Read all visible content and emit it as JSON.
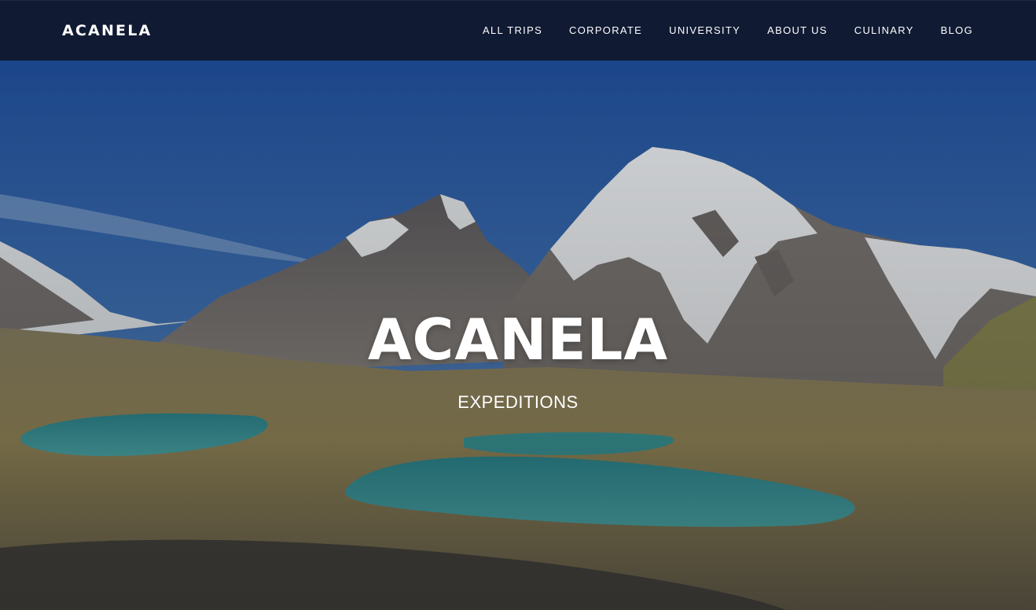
{
  "brand": {
    "logo_text": "ACANELA"
  },
  "nav": {
    "items": [
      {
        "label": "ALL TRIPS"
      },
      {
        "label": "CORPORATE"
      },
      {
        "label": "UNIVERSITY"
      },
      {
        "label": "ABOUT US"
      },
      {
        "label": "CULINARY"
      },
      {
        "label": "BLOG"
      }
    ]
  },
  "hero": {
    "title": "ACANELA",
    "subtitle": "EXPEDITIONS",
    "image": "mountain-lakes-landscape"
  },
  "colors": {
    "nav_background": "#101a33",
    "text": "#ffffff",
    "sky": "#2b5ca8",
    "lake": "#3fa3a8"
  }
}
